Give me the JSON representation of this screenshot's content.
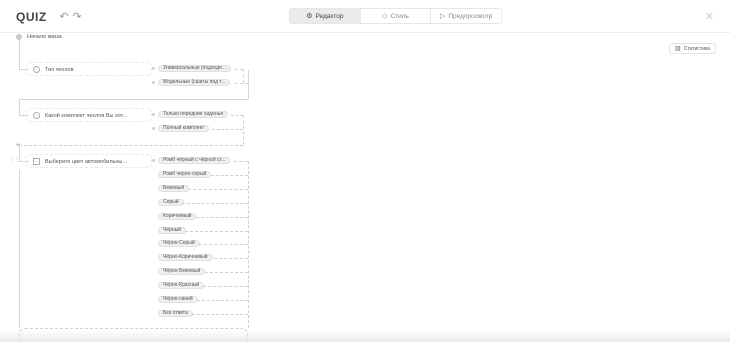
{
  "header": {
    "logo": "QUIZ",
    "undo_icon": "undo-icon",
    "redo_icon": "redo-icon",
    "tabs": [
      {
        "label": "Редактор",
        "icon": "editor-icon",
        "active": true
      },
      {
        "label": "Стиль",
        "icon": "style-icon",
        "active": false
      },
      {
        "label": "Предпросмотр",
        "icon": "play-icon",
        "active": false
      }
    ],
    "close_icon": "close-icon"
  },
  "canvas": {
    "start_label": "Начало квиза",
    "stats_label": "Статистика",
    "questions": [
      {
        "title": "Тип чехлов",
        "answers": [
          "Универсальные (подходя...",
          "Модельные (сшиты под т..."
        ]
      },
      {
        "title": "Какой комплект чехлов Вы хот...",
        "answers": [
          "Только передние сиденья",
          "Полный комплект"
        ]
      },
      {
        "title": "Выберите цвет автомобильны...",
        "answers": [
          "Ромб чёрный с чёрной ст...",
          "Ромб черно-серый",
          "Бежевый",
          "Серый",
          "Коричневый",
          "Чёрный",
          "Чёрно-Серый",
          "Чёрно-Коричневый",
          "Чёрно-Бежевый",
          "Чёрно-Красный",
          "Чёрно-синей",
          "Без ответа"
        ]
      }
    ]
  }
}
